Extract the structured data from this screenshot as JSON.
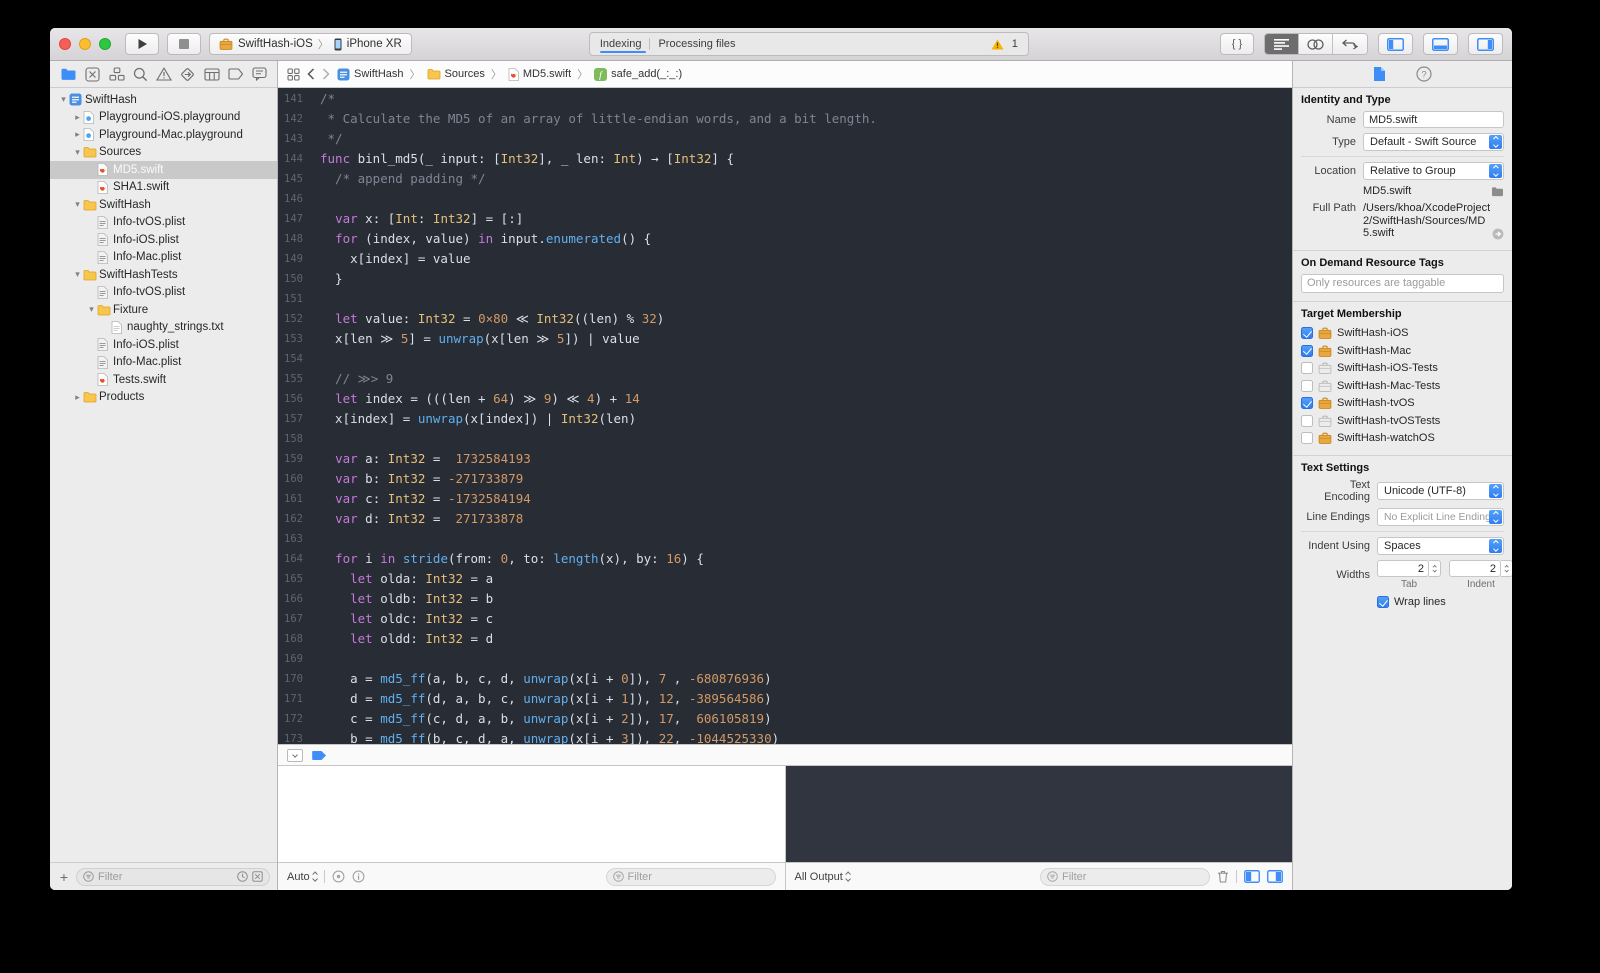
{
  "colors": {
    "accent_blue": "#3f8ef7",
    "editor_bg": "#282c34",
    "console_bg": "#31353f",
    "syntax_keyword": "#c678dd",
    "syntax_type": "#e5c07b",
    "syntax_number": "#d19a66",
    "syntax_function": "#61afef",
    "syntax_comment": "#7e8594",
    "syntax_plain": "#dcdfe6",
    "warning_yellow": "#f7b500",
    "folder_yellow": "#f7c64c"
  },
  "titlebar": {
    "scheme": "SwiftHash-iOS",
    "device": "iPhone XR",
    "separator": "〉",
    "status_primary": "Indexing",
    "status_secondary": "Processing files",
    "warning_count": "1",
    "braces_label": "{ }"
  },
  "navigator": {
    "tabs": [
      "project",
      "source-control",
      "symbols",
      "find",
      "issues",
      "tests",
      "debug",
      "breakpoints",
      "reports"
    ],
    "active_tab": 0,
    "add_label": "+",
    "filter_placeholder": "Filter",
    "tree": [
      {
        "label": "SwiftHash",
        "level": 0,
        "icon": "proj",
        "disclosure": "open",
        "selected": false
      },
      {
        "label": "Playground-iOS.playground",
        "level": 1,
        "icon": "playground",
        "disclosure": "closed",
        "selected": false
      },
      {
        "label": "Playground-Mac.playground",
        "level": 1,
        "icon": "playground",
        "disclosure": "closed",
        "selected": false
      },
      {
        "label": "Sources",
        "level": 1,
        "icon": "folder",
        "disclosure": "open",
        "selected": false
      },
      {
        "label": "MD5.swift",
        "level": 2,
        "icon": "swift",
        "disclosure": null,
        "selected": true
      },
      {
        "label": "SHA1.swift",
        "level": 2,
        "icon": "swift",
        "disclosure": null,
        "selected": false
      },
      {
        "label": "SwiftHash",
        "level": 1,
        "icon": "folder",
        "disclosure": "open",
        "selected": false
      },
      {
        "label": "Info-tvOS.plist",
        "level": 2,
        "icon": "plist",
        "disclosure": null,
        "selected": false
      },
      {
        "label": "Info-iOS.plist",
        "level": 2,
        "icon": "plist",
        "disclosure": null,
        "selected": false
      },
      {
        "label": "Info-Mac.plist",
        "level": 2,
        "icon": "plist",
        "disclosure": null,
        "selected": false
      },
      {
        "label": "SwiftHashTests",
        "level": 1,
        "icon": "folder",
        "disclosure": "open",
        "selected": false
      },
      {
        "label": "Info-tvOS.plist",
        "level": 2,
        "icon": "plist",
        "disclosure": null,
        "selected": false
      },
      {
        "label": "Fixture",
        "level": 2,
        "icon": "folder",
        "disclosure": "open",
        "selected": false
      },
      {
        "label": "naughty_strings.txt",
        "level": 3,
        "icon": "txt",
        "disclosure": null,
        "selected": false
      },
      {
        "label": "Info-iOS.plist",
        "level": 2,
        "icon": "plist",
        "disclosure": null,
        "selected": false
      },
      {
        "label": "Info-Mac.plist",
        "level": 2,
        "icon": "plist",
        "disclosure": null,
        "selected": false
      },
      {
        "label": "Tests.swift",
        "level": 2,
        "icon": "swift",
        "disclosure": null,
        "selected": false
      },
      {
        "label": "Products",
        "level": 1,
        "icon": "folder",
        "disclosure": "closed",
        "selected": false
      }
    ]
  },
  "jumpbar": {
    "separator": "〉",
    "crumbs": [
      {
        "icon": "proj",
        "label": "SwiftHash"
      },
      {
        "icon": "folder",
        "label": "Sources"
      },
      {
        "icon": "swift",
        "label": "MD5.swift"
      },
      {
        "icon": "func",
        "label": "safe_add(_:_:)"
      }
    ]
  },
  "editor": {
    "lines": [
      {
        "no": "141",
        "segs": [
          [
            "c",
            "/*"
          ]
        ]
      },
      {
        "no": "142",
        "segs": [
          [
            "c",
            " * Calculate the MD5 of an array of little-endian words, and a bit length."
          ]
        ]
      },
      {
        "no": "143",
        "segs": [
          [
            "c",
            " */"
          ]
        ]
      },
      {
        "no": "144",
        "segs": [
          [
            "k",
            "func"
          ],
          [
            "p",
            " binl_md5(_ input: ["
          ],
          [
            "t",
            "Int32"
          ],
          [
            "p",
            "], _ len: "
          ],
          [
            "t",
            "Int"
          ],
          [
            "p",
            ") → ["
          ],
          [
            "t",
            "Int32"
          ],
          [
            "p",
            "] {"
          ]
        ]
      },
      {
        "no": "145",
        "segs": [
          [
            "c",
            "  /* append padding */"
          ]
        ]
      },
      {
        "no": "146",
        "segs": []
      },
      {
        "no": "147",
        "segs": [
          [
            "p",
            "  "
          ],
          [
            "k",
            "var"
          ],
          [
            "p",
            " x: ["
          ],
          [
            "t",
            "Int"
          ],
          [
            "p",
            ": "
          ],
          [
            "t",
            "Int32"
          ],
          [
            "p",
            "] = [:]"
          ]
        ]
      },
      {
        "no": "148",
        "segs": [
          [
            "p",
            "  "
          ],
          [
            "k",
            "for"
          ],
          [
            "p",
            " (index, value) "
          ],
          [
            "k",
            "in"
          ],
          [
            "p",
            " input."
          ],
          [
            "f",
            "enumerated"
          ],
          [
            "p",
            "() {"
          ]
        ]
      },
      {
        "no": "149",
        "segs": [
          [
            "p",
            "    x[index] = value"
          ]
        ]
      },
      {
        "no": "150",
        "segs": [
          [
            "p",
            "  }"
          ]
        ]
      },
      {
        "no": "151",
        "segs": []
      },
      {
        "no": "152",
        "segs": [
          [
            "p",
            "  "
          ],
          [
            "k",
            "let"
          ],
          [
            "p",
            " value: "
          ],
          [
            "t",
            "Int32"
          ],
          [
            "p",
            " = "
          ],
          [
            "n",
            "0×80"
          ],
          [
            "p",
            " ≪ "
          ],
          [
            "t",
            "Int32"
          ],
          [
            "p",
            "((len) % "
          ],
          [
            "n",
            "32"
          ],
          [
            "p",
            ")"
          ]
        ]
      },
      {
        "no": "153",
        "segs": [
          [
            "p",
            "  x[len ≫ "
          ],
          [
            "n",
            "5"
          ],
          [
            "p",
            "] = "
          ],
          [
            "f",
            "unwrap"
          ],
          [
            "p",
            "(x[len ≫ "
          ],
          [
            "n",
            "5"
          ],
          [
            "p",
            "]) | value"
          ]
        ]
      },
      {
        "no": "154",
        "segs": []
      },
      {
        "no": "155",
        "segs": [
          [
            "c",
            "  // ≫> 9"
          ]
        ]
      },
      {
        "no": "156",
        "segs": [
          [
            "p",
            "  "
          ],
          [
            "k",
            "let"
          ],
          [
            "p",
            " index = (((len + "
          ],
          [
            "n",
            "64"
          ],
          [
            "p",
            ") ≫ "
          ],
          [
            "n",
            "9"
          ],
          [
            "p",
            ") ≪ "
          ],
          [
            "n",
            "4"
          ],
          [
            "p",
            ") + "
          ],
          [
            "n",
            "14"
          ]
        ]
      },
      {
        "no": "157",
        "segs": [
          [
            "p",
            "  x[index] = "
          ],
          [
            "f",
            "unwrap"
          ],
          [
            "p",
            "(x[index]) | "
          ],
          [
            "t",
            "Int32"
          ],
          [
            "p",
            "(len)"
          ]
        ]
      },
      {
        "no": "158",
        "segs": []
      },
      {
        "no": "159",
        "segs": [
          [
            "p",
            "  "
          ],
          [
            "k",
            "var"
          ],
          [
            "p",
            " a: "
          ],
          [
            "t",
            "Int32"
          ],
          [
            "p",
            " =  "
          ],
          [
            "n",
            "1732584193"
          ]
        ]
      },
      {
        "no": "160",
        "segs": [
          [
            "p",
            "  "
          ],
          [
            "k",
            "var"
          ],
          [
            "p",
            " b: "
          ],
          [
            "t",
            "Int32"
          ],
          [
            "p",
            " = "
          ],
          [
            "n",
            "-271733879"
          ]
        ]
      },
      {
        "no": "161",
        "segs": [
          [
            "p",
            "  "
          ],
          [
            "k",
            "var"
          ],
          [
            "p",
            " c: "
          ],
          [
            "t",
            "Int32"
          ],
          [
            "p",
            " = "
          ],
          [
            "n",
            "-1732584194"
          ]
        ]
      },
      {
        "no": "162",
        "segs": [
          [
            "p",
            "  "
          ],
          [
            "k",
            "var"
          ],
          [
            "p",
            " d: "
          ],
          [
            "t",
            "Int32"
          ],
          [
            "p",
            " =  "
          ],
          [
            "n",
            "271733878"
          ]
        ]
      },
      {
        "no": "163",
        "segs": []
      },
      {
        "no": "164",
        "segs": [
          [
            "p",
            "  "
          ],
          [
            "k",
            "for"
          ],
          [
            "p",
            " i "
          ],
          [
            "k",
            "in"
          ],
          [
            "p",
            " "
          ],
          [
            "f",
            "stride"
          ],
          [
            "p",
            "(from: "
          ],
          [
            "n",
            "0"
          ],
          [
            "p",
            ", to: "
          ],
          [
            "f",
            "length"
          ],
          [
            "p",
            "(x), by: "
          ],
          [
            "n",
            "16"
          ],
          [
            "p",
            ") {"
          ]
        ]
      },
      {
        "no": "165",
        "segs": [
          [
            "p",
            "    "
          ],
          [
            "k",
            "let"
          ],
          [
            "p",
            " olda: "
          ],
          [
            "t",
            "Int32"
          ],
          [
            "p",
            " = a"
          ]
        ]
      },
      {
        "no": "166",
        "segs": [
          [
            "p",
            "    "
          ],
          [
            "k",
            "let"
          ],
          [
            "p",
            " oldb: "
          ],
          [
            "t",
            "Int32"
          ],
          [
            "p",
            " = b"
          ]
        ]
      },
      {
        "no": "167",
        "segs": [
          [
            "p",
            "    "
          ],
          [
            "k",
            "let"
          ],
          [
            "p",
            " oldc: "
          ],
          [
            "t",
            "Int32"
          ],
          [
            "p",
            " = c"
          ]
        ]
      },
      {
        "no": "168",
        "segs": [
          [
            "p",
            "    "
          ],
          [
            "k",
            "let"
          ],
          [
            "p",
            " oldd: "
          ],
          [
            "t",
            "Int32"
          ],
          [
            "p",
            " = d"
          ]
        ]
      },
      {
        "no": "169",
        "segs": []
      },
      {
        "no": "170",
        "segs": [
          [
            "p",
            "    a = "
          ],
          [
            "f",
            "md5_ff"
          ],
          [
            "p",
            "(a, b, c, d, "
          ],
          [
            "f",
            "unwrap"
          ],
          [
            "p",
            "(x[i + "
          ],
          [
            "n",
            "0"
          ],
          [
            "p",
            "]), "
          ],
          [
            "n",
            "7"
          ],
          [
            "p",
            " , "
          ],
          [
            "n",
            "-680876936"
          ],
          [
            "p",
            ")"
          ]
        ]
      },
      {
        "no": "171",
        "segs": [
          [
            "p",
            "    d = "
          ],
          [
            "f",
            "md5_ff"
          ],
          [
            "p",
            "(d, a, b, c, "
          ],
          [
            "f",
            "unwrap"
          ],
          [
            "p",
            "(x[i + "
          ],
          [
            "n",
            "1"
          ],
          [
            "p",
            "]), "
          ],
          [
            "n",
            "12"
          ],
          [
            "p",
            ", "
          ],
          [
            "n",
            "-389564586"
          ],
          [
            "p",
            ")"
          ]
        ]
      },
      {
        "no": "172",
        "segs": [
          [
            "p",
            "    c = "
          ],
          [
            "f",
            "md5_ff"
          ],
          [
            "p",
            "(c, d, a, b, "
          ],
          [
            "f",
            "unwrap"
          ],
          [
            "p",
            "(x[i + "
          ],
          [
            "n",
            "2"
          ],
          [
            "p",
            "]), "
          ],
          [
            "n",
            "17"
          ],
          [
            "p",
            ",  "
          ],
          [
            "n",
            "606105819"
          ],
          [
            "p",
            ")"
          ]
        ]
      },
      {
        "no": "173",
        "segs": [
          [
            "p",
            "    b = "
          ],
          [
            "f",
            "md5_ff"
          ],
          [
            "p",
            "(b, c, d, a, "
          ],
          [
            "f",
            "unwrap"
          ],
          [
            "p",
            "(x[i + "
          ],
          [
            "n",
            "3"
          ],
          [
            "p",
            "]), "
          ],
          [
            "n",
            "22"
          ],
          [
            "p",
            ", "
          ],
          [
            "n",
            "-1044525330"
          ],
          [
            "p",
            ")"
          ]
        ]
      }
    ]
  },
  "debug": {
    "variables_scope": "Auto",
    "variables_filter_placeholder": "Filter",
    "console_scope": "All Output",
    "console_filter_placeholder": "Filter"
  },
  "inspector": {
    "identity": {
      "title": "Identity and Type",
      "name_label": "Name",
      "name_value": "MD5.swift",
      "type_label": "Type",
      "type_value": "Default - Swift Source",
      "location_label": "Location",
      "location_value": "Relative to Group",
      "location_file": "MD5.swift",
      "fullpath_label": "Full Path",
      "fullpath_value": "/Users/khoa/XcodeProject2/SwiftHash/Sources/MD5.swift"
    },
    "odr": {
      "title": "On Demand Resource Tags",
      "placeholder": "Only resources are taggable"
    },
    "membership": {
      "title": "Target Membership",
      "targets": [
        {
          "label": "SwiftHash-iOS",
          "checked": true,
          "icon": "toolbox"
        },
        {
          "label": "SwiftHash-Mac",
          "checked": true,
          "icon": "toolbox"
        },
        {
          "label": "SwiftHash-iOS-Tests",
          "checked": false,
          "icon": "toolbox-gray"
        },
        {
          "label": "SwiftHash-Mac-Tests",
          "checked": false,
          "icon": "toolbox-gray"
        },
        {
          "label": "SwiftHash-tvOS",
          "checked": true,
          "icon": "toolbox"
        },
        {
          "label": "SwiftHash-tvOSTests",
          "checked": false,
          "icon": "toolbox-gray"
        },
        {
          "label": "SwiftHash-watchOS",
          "checked": false,
          "icon": "toolbox"
        }
      ]
    },
    "text_settings": {
      "title": "Text Settings",
      "encoding_label": "Text Encoding",
      "encoding_value": "Unicode (UTF-8)",
      "line_endings_label": "Line Endings",
      "line_endings_value": "No Explicit Line Endings",
      "indent_label": "Indent Using",
      "indent_value": "Spaces",
      "widths_label": "Widths",
      "tab_value": "2",
      "tab_caption": "Tab",
      "indent_width_value": "2",
      "indent_caption": "Indent",
      "wrap_label": "Wrap lines",
      "wrap_checked": true
    }
  }
}
